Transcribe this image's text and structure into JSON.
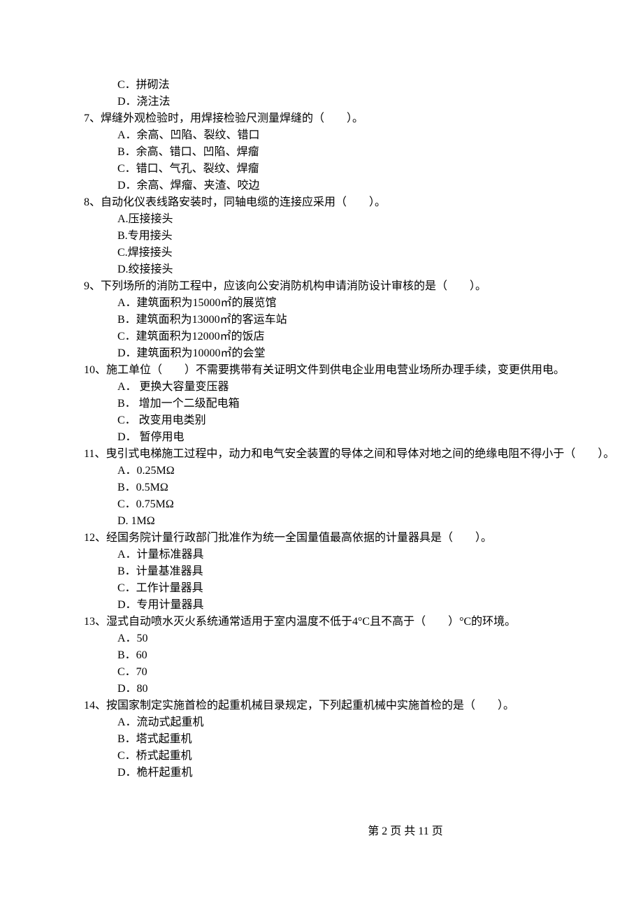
{
  "orphan_options": {
    "C": "C．拼砌法",
    "D": "D．浇注法"
  },
  "questions": [
    {
      "text": "7、焊缝外观检验时，用焊接检验尺测量焊缝的（　　）。",
      "options": [
        "A．余高、凹陷、裂纹、错口",
        "B．余高、错口、凹陷、焊瘤",
        "C．错口、气孔、裂纹、焊瘤",
        "D．余高、焊瘤、夹渣、咬边"
      ]
    },
    {
      "text": "8、自动化仪表线路安装时，同轴电缆的连接应采用（　　）。",
      "options": [
        "A.压接接头",
        "B.专用接头",
        "C.焊接接头",
        "D.绞接接头"
      ]
    },
    {
      "text": "9、下列场所的消防工程中，应该向公安消防机构申请消防设计审核的是（　　）。",
      "options": [
        "A．建筑面积为15000㎡的展览馆",
        "B．建筑面积为13000㎡的客运车站",
        "C．建筑面积为12000㎡的饭店",
        "D．建筑面积为10000㎡的会堂"
      ]
    },
    {
      "text": "10、施工单位（　　）不需要携带有关证明文件到供电企业用电营业场所办理手续，变更供用电。",
      "options": [
        "A． 更换大容量变压器",
        "B． 增加一个二级配电箱",
        "C． 改变用电类别",
        "D． 暂停用电"
      ]
    },
    {
      "text": "11、曳引式电梯施工过程中，动力和电气安全装置的导体之间和导体对地之间的绝缘电阻不得小于（　　）。",
      "options": [
        "A．0.25MΩ",
        "B．0.5MΩ",
        "C．0.75MΩ",
        "D. 1MΩ"
      ]
    },
    {
      "text": "12、经国务院计量行政部门批准作为统一全国量值最高依据的计量器具是（　　）。",
      "options": [
        "A．计量标准器具",
        "B．计量基准器具",
        "C．工作计量器具",
        "D．专用计量器具"
      ]
    },
    {
      "text": "13、湿式自动喷水灭火系统通常适用于室内温度不低于4°C且不高于（　　）°C的环境。",
      "options": [
        "A．50",
        "B．60",
        "C．70",
        "D．80"
      ]
    },
    {
      "text": "14、按国家制定实施首检的起重机械目录规定，下列起重机械中实施首检的是（　　）。",
      "options": [
        "A．流动式起重机",
        "B．塔式起重机",
        "C．桥式起重机",
        "D．桅杆起重机"
      ]
    }
  ],
  "footer": "第 2 页 共 11 页"
}
